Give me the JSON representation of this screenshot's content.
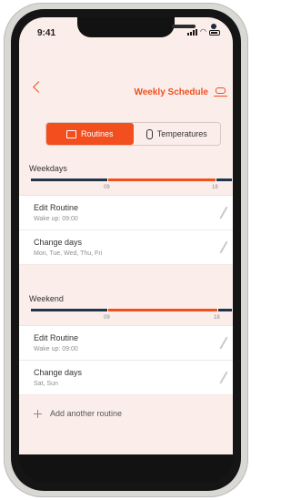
{
  "status_bar": {
    "time": "9:41"
  },
  "header": {
    "title": "Weekly Schedule"
  },
  "tabs": [
    {
      "label": "Routines",
      "active": true
    },
    {
      "label": "Temperatures",
      "active": false
    }
  ],
  "weekdays": {
    "title": "Weekdays",
    "timeline_labels": [
      "09",
      "18"
    ],
    "routine": {
      "title": "Edit Routine",
      "subtitle": "Wake up: 09:00"
    },
    "days": {
      "title": "Change days",
      "subtitle": "Mon, Tue, Wed, Thu, Fri"
    }
  },
  "weekend": {
    "title": "Weekend",
    "timeline_labels": [
      "09",
      "18"
    ],
    "routine": {
      "title": "Edit Routine",
      "subtitle": "Wake up: 09:00"
    },
    "days": {
      "title": "Change days",
      "subtitle": "Sat, Sun"
    }
  },
  "add_routine": {
    "label": "Add another routine"
  },
  "colors": {
    "accent": "#f24e1e",
    "night": "#22344a",
    "background": "#fbeeea"
  }
}
